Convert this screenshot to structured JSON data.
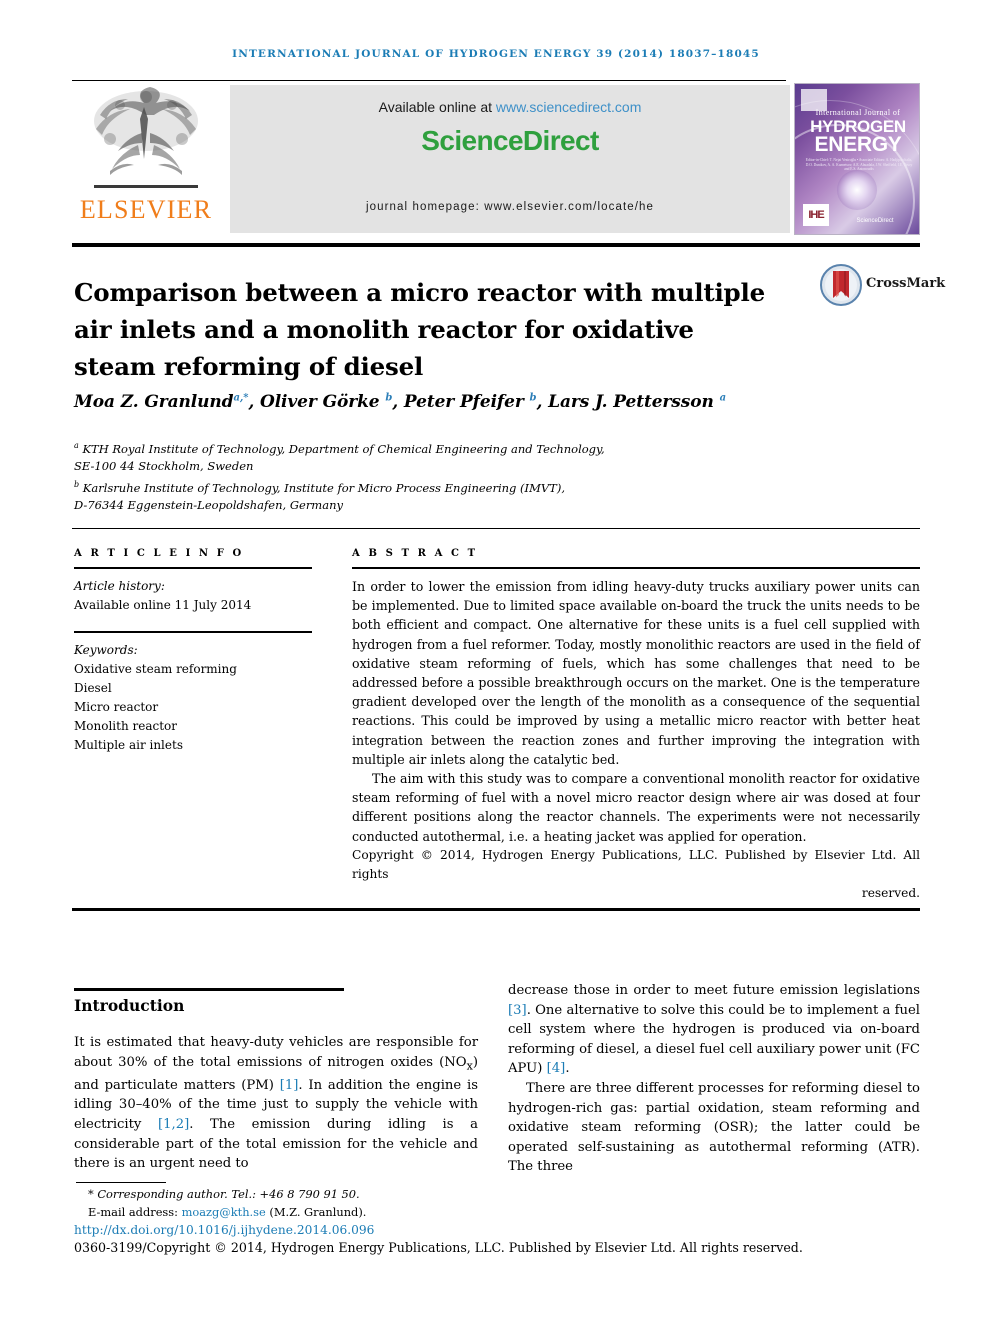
{
  "journal": {
    "running_head": "International Journal of Hydrogen Energy 39 (2014) 18037–18045",
    "publisher_name": "ELSEVIER",
    "available_online_prefix": "Available online at ",
    "sciencedirect_url": "www.sciencedirect.com",
    "sciencedirect_logo": "ScienceDirect",
    "homepage_line": "journal homepage: www.elsevier.com/locate/he",
    "cover": {
      "line1": "International Journal of",
      "line2": "HYDROGEN",
      "line3": "ENERGY",
      "editors": "Editor-in-Chief: T. Nejat Veziroğlu • Associate Editors: A. Hadjipaschalis, D.O. Dunikov, A. A. Kuznetsov, A.E. Abuadala, J.W. Sheffield, I.E. Ersoy and E.S. Antonoudis",
      "badge": "IHE",
      "sciencedirect": "ScienceDirect"
    }
  },
  "article": {
    "title": "Comparison between a micro reactor with multiple air inlets and a monolith reactor for oxidative steam reforming of diesel",
    "crossmark_label": "CrossMark",
    "authors": [
      {
        "name": "Moa Z. Granlund",
        "sup": "a,*"
      },
      {
        "name": "Oliver Görke",
        "sup": "b"
      },
      {
        "name": "Peter Pfeifer",
        "sup": "b"
      },
      {
        "name": "Lars J. Pettersson",
        "sup": "a"
      }
    ],
    "affiliations": [
      {
        "marker": "a",
        "line1": "KTH Royal Institute of Technology, Department of Chemical Engineering and Technology,",
        "line2": "SE-100 44 Stockholm, Sweden"
      },
      {
        "marker": "b",
        "line1": "Karlsruhe Institute of Technology, Institute for Micro Process Engineering (IMVT),",
        "line2": "D-76344 Eggenstein-Leopoldshafen, Germany"
      }
    ]
  },
  "article_info": {
    "heading": "A R T I C L E  I N F O",
    "history_label": "Article history:",
    "history_value": "Available online 11 July 2014",
    "keywords_label": "Keywords:",
    "keywords": [
      "Oxidative steam reforming",
      "Diesel",
      "Micro reactor",
      "Monolith reactor",
      "Multiple air inlets"
    ]
  },
  "abstract": {
    "heading": "A B S T R A C T",
    "paragraph_1": "In order to lower the emission from idling heavy-duty trucks auxiliary power units can be implemented. Due to limited space available on-board the truck the units needs to be both efficient and compact. One alternative for these units is a fuel cell supplied with hydrogen from a fuel reformer. Today, mostly monolithic reactors are used in the field of oxidative steam reforming of fuels, which has some challenges that need to be addressed before a possible breakthrough occurs on the market. One is the temperature gradient developed over the length of the monolith as a consequence of the sequential reactions. This could be improved by using a metallic micro reactor with better heat integration between the reaction zones and further improving the integration with multiple air inlets along the catalytic bed.",
    "paragraph_2": "The aim with this study was to compare a conventional monolith reactor for oxidative steam reforming of fuel with a novel micro reactor design where air was dosed at four different positions along the reactor channels. The experiments were not necessarily conducted autothermal, i.e. a heating jacket was applied for operation.",
    "copyright_main": "Copyright © 2014, Hydrogen Energy Publications, LLC. Published by Elsevier Ltd. All rights",
    "copyright_last": "reserved."
  },
  "body": {
    "intro_heading": "Introduction",
    "left_para_1_a": "It is estimated that heavy-duty vehicles are responsible for about 30% of the total emissions of nitrogen oxides (NO",
    "left_para_1_sub": "x",
    "left_para_1_b": ") and particulate matters (PM) ",
    "cite_1": "[1]",
    "left_para_1_c": ". In addition the engine is idling 30–40% of the time just to supply the vehicle with electricity ",
    "cite_12": "[1,2]",
    "left_para_1_d": ". The emission during idling is a considerable part of the total emission for the vehicle and there is an urgent need to",
    "right_para_1_a": "decrease those in order to meet future emission legislations ",
    "cite_3": "[3]",
    "right_para_1_b": ". One alternative to solve this could be to implement a fuel cell system where the hydrogen is produced via on-board reforming of diesel, a diesel fuel cell auxiliary power unit (FC APU) ",
    "cite_4": "[4]",
    "right_para_1_c": ".",
    "right_para_2": "There are three different processes for reforming diesel to hydrogen-rich gas: partial oxidation, steam reforming and oxidative steam reforming (OSR); the latter could be operated self-sustaining as autothermal reforming (ATR). The three"
  },
  "footer": {
    "corresponding_marker": "*",
    "corresponding_text": "Corresponding author. Tel.: +46 8 790 91 50.",
    "email_label": "E-mail address: ",
    "email": "moazg@kth.se",
    "email_suffix": " (M.Z. Granlund).",
    "doi": "http://dx.doi.org/10.1016/j.ijhydene.2014.06.096",
    "issn_line": "0360-3199/Copyright © 2014, Hydrogen Energy Publications, LLC. Published by Elsevier Ltd. All rights reserved."
  },
  "colors": {
    "link_blue": "#1b7cb5",
    "sciencedirect_green": "#2fa03e",
    "elsevier_orange": "#f07d1a",
    "crossmark_red": "#c1272d"
  }
}
